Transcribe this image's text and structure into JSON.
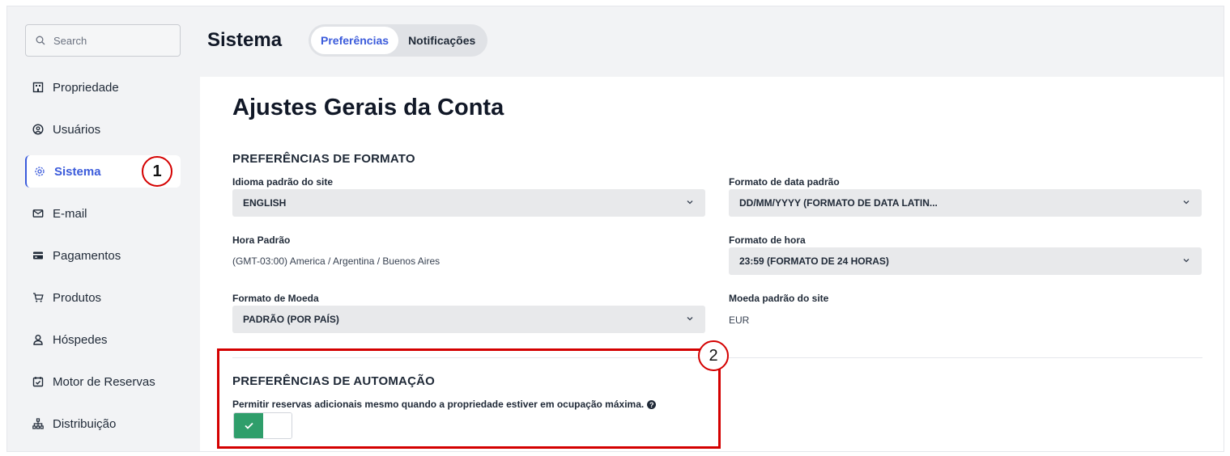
{
  "search": {
    "placeholder": "Search"
  },
  "sidebar": {
    "items": [
      {
        "label": "Propriedade",
        "icon": "building-icon"
      },
      {
        "label": "Usuários",
        "icon": "user-circle-icon"
      },
      {
        "label": "Sistema",
        "icon": "gear-icon",
        "active": true
      },
      {
        "label": "E-mail",
        "icon": "mail-icon"
      },
      {
        "label": "Pagamentos",
        "icon": "credit-card-icon"
      },
      {
        "label": "Produtos",
        "icon": "cart-icon"
      },
      {
        "label": "Hóspedes",
        "icon": "user-icon"
      },
      {
        "label": "Motor de Reservas",
        "icon": "calendar-check-icon"
      },
      {
        "label": "Distribuição",
        "icon": "hierarchy-icon"
      }
    ]
  },
  "header": {
    "title": "Sistema",
    "tabs": [
      {
        "label": "Preferências",
        "active": true
      },
      {
        "label": "Notificações",
        "active": false
      }
    ]
  },
  "annotations": {
    "badge1": "1",
    "badge2": "2"
  },
  "main": {
    "heading": "Ajustes Gerais da Conta",
    "format_section": {
      "title": "PREFERÊNCIAS DE FORMATO",
      "language_label": "Idioma padrão do site",
      "language_value": "ENGLISH",
      "date_format_label": "Formato de data padrão",
      "date_format_value": "DD/MM/YYYY (FORMATO DE DATA LATIN...",
      "time_label": "Hora Padrão",
      "time_value": "(GMT-03:00) America / Argentina / Buenos Aires",
      "hour_format_label": "Formato de hora",
      "hour_format_value": "23:59 (FORMATO DE 24 HORAS)",
      "currency_format_label": "Formato de Moeda",
      "currency_format_value": "PADRÃO (POR PAÍS)",
      "currency_label": "Moeda padrão do site",
      "currency_value": "EUR"
    },
    "automation_section": {
      "title": "PREFERÊNCIAS DE AUTOMAÇÃO",
      "overbooking_label": "Permitir reservas adicionais mesmo quando a propriedade estiver em ocupação máxima.",
      "overbooking_enabled": true
    }
  },
  "colors": {
    "accent": "#3b5bdb",
    "toggle_on": "#2f9e6b",
    "annotation": "#d40000"
  }
}
